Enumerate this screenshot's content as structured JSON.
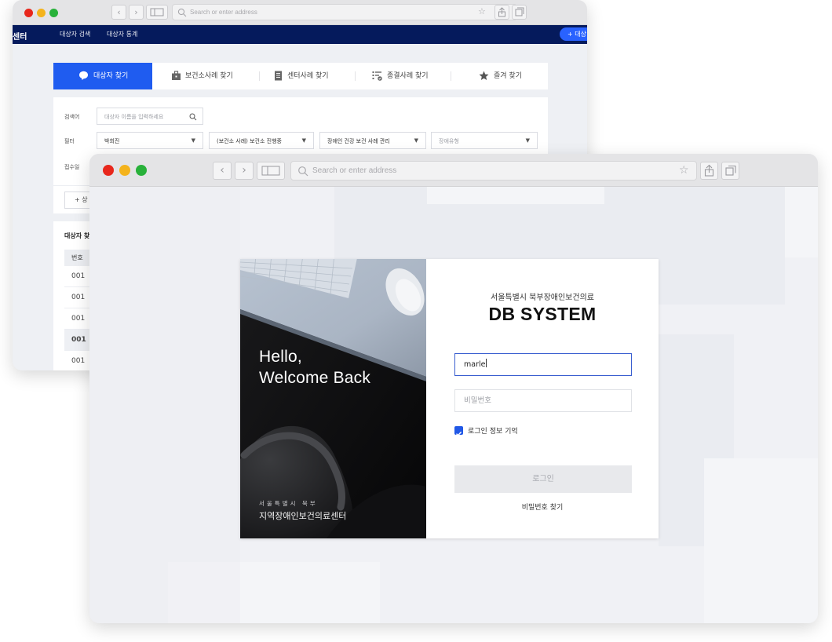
{
  "colors": {
    "traffic_red": "#e8271c",
    "traffic_yellow": "#f4b31c",
    "traffic_green": "#28b13a",
    "nav_navy": "#051a5c",
    "accent_blue": "#1f5cf0",
    "checkbox_blue": "#2158e6"
  },
  "back_window": {
    "address_placeholder": "Search or enter address",
    "nav": {
      "brand_fragment": "센터",
      "items": [
        "대상자 검색",
        "대상자 통계"
      ],
      "add_button_label": "+ 대상"
    },
    "tabs": [
      {
        "label": "대상자 찾기",
        "icon": "chat-bubble-icon",
        "active": true
      },
      {
        "label": "보건소사례 찾기",
        "icon": "briefcase-icon",
        "active": false
      },
      {
        "label": "센터사례 찾기",
        "icon": "document-icon",
        "active": false
      },
      {
        "label": "종결사례 찾기",
        "icon": "checklist-icon",
        "active": false
      },
      {
        "label": "즐겨 찾기",
        "icon": "star-icon",
        "active": false
      }
    ],
    "search_form": {
      "keyword_label": "검색어",
      "keyword_placeholder": "대상자 이름을 입력하세요",
      "filter_label": "필터",
      "filters": [
        "박희진",
        "(보건소 사례) 보건소 진행중",
        "장애인 건강 보건 사례 관리",
        "장애유형"
      ],
      "date_label": "접수일",
      "detail_button_fragment": "+ 상"
    },
    "results": {
      "title_fragment": "대상자 찾",
      "column_header_fragment": "번호",
      "rows": [
        "001",
        "001",
        "001",
        "001",
        "001"
      ]
    }
  },
  "front_window": {
    "address_placeholder": "Search or enter address",
    "photo_panel": {
      "greeting_line1": "Hello,",
      "greeting_line2": "Welcome Back",
      "org_subtitle": "서울특별시 북부",
      "org_name": "지역장애인보건의료센터"
    },
    "login_form": {
      "org_title": "서울특별시 북부장애인보건의료",
      "system_title": "DB SYSTEM",
      "username_value": "marle",
      "password_placeholder": "비밀번호",
      "remember_label": "로그인 정보 기억",
      "remember_checked": true,
      "login_button_label": "로그인",
      "find_password_label": "비밀번호 찾기"
    }
  }
}
